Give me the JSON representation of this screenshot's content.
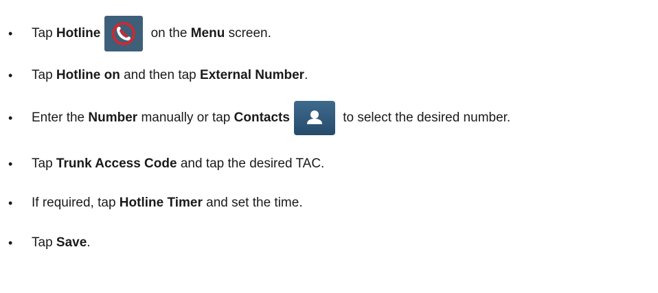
{
  "steps": [
    {
      "pre": "Tap ",
      "b1": "Hotline",
      "mid": " on the ",
      "b2": "Menu",
      "post": " screen.",
      "icon": "hotline-phone-icon"
    },
    {
      "pre": "Tap ",
      "b1": "Hotline on",
      "mid": " and then tap ",
      "b2": "External Number",
      "post": "."
    },
    {
      "pre": "Enter the ",
      "b1": "Number",
      "mid": " manually or tap ",
      "b2": "Contacts",
      "post": " to select the desired number.",
      "icon": "contacts-person-icon"
    },
    {
      "pre": "Tap ",
      "b1": "Trunk Access Code",
      "post": " and tap the desired TAC."
    },
    {
      "pre": "If required, tap ",
      "b1": "Hotline Timer",
      "post": " and set the time."
    },
    {
      "pre": "Tap ",
      "b1": "Save",
      "post": "."
    }
  ],
  "bullet": "•",
  "colors": {
    "hotline_icon_bg": "#3e5f79",
    "contacts_icon_bg": "#2f5678",
    "hotline_icon_slash": "#d9252a"
  }
}
